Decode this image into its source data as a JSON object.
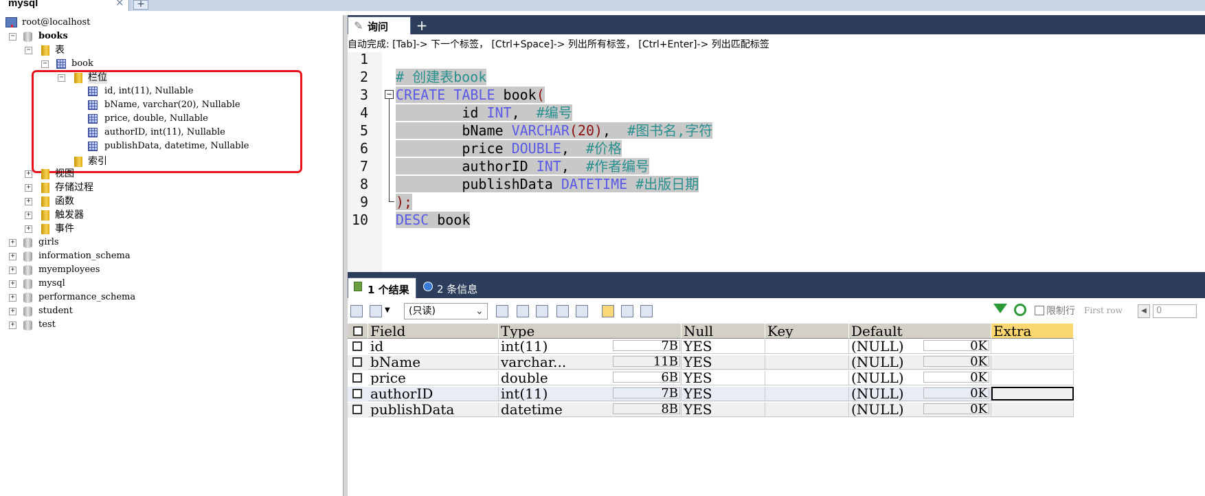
{
  "window": {
    "connection_tab": "mysql",
    "close_symbol": "✕",
    "add_symbol": "+"
  },
  "tree": {
    "root": "root@localhost",
    "db_books": "books",
    "tables_folder": "表",
    "table_book": "book",
    "columns_folder": "栏位",
    "columns": [
      "id, int(11), Nullable",
      "bName, varchar(20), Nullable",
      "price, double, Nullable",
      "authorID, int(11), Nullable",
      "publishData, datetime, Nullable"
    ],
    "index_folder": "索引",
    "folders": [
      "视图",
      "存储过程",
      "函数",
      "触发器",
      "事件"
    ],
    "databases": [
      "girls",
      "information_schema",
      "myemployees",
      "mysql",
      "performance_schema",
      "student",
      "test"
    ]
  },
  "editor": {
    "tab_label": "询问",
    "add_symbol": "+",
    "autocomplete_hint": "自动完成: [Tab]-> 下一个标签， [Ctrl+Space]-> 列出所有标签， [Ctrl+Enter]-> 列出匹配标签",
    "line_numbers": [
      "1",
      "2",
      "3",
      "4",
      "5",
      "6",
      "7",
      "8",
      "9",
      "10"
    ],
    "lines": {
      "l2": "# 创建表book",
      "l3_kw": "CREATE TABLE",
      "l3_rest": " book",
      "l3_paren": "(",
      "l4_name": "        id ",
      "l4_type": "INT",
      "l4_sep": ",  ",
      "l4_cm": "#编号",
      "l5_name": "        bName ",
      "l5_type": "VARCHAR",
      "l5_args": "(20)",
      "l5_sep": ",  ",
      "l5_cm": "#图书名,字符",
      "l6_name": "        price ",
      "l6_type": "DOUBLE",
      "l6_sep": ",  ",
      "l6_cm": "#价格",
      "l7_name": "        authorID ",
      "l7_type": "INT",
      "l7_sep": ",  ",
      "l7_cm": "#作者编号",
      "l8_name": "        publishData ",
      "l8_type": "DATETIME",
      "l8_sep": " ",
      "l8_cm": "#出版日期",
      "l9": ");",
      "l10_kw": "DESC",
      "l10_rest": " book"
    }
  },
  "results": {
    "tab_result": "1 个结果",
    "tab_info": "2 条信息",
    "mode_select": "(只读)",
    "limit_label": "限制行",
    "first_row_label": "First row",
    "first_row_value": "0",
    "columns": [
      "Field",
      "Type",
      "Null",
      "Key",
      "Default",
      "Extra"
    ],
    "rows": [
      {
        "field": "id",
        "type": "int(11)",
        "type_size": "7B",
        "null": "YES",
        "key": "",
        "default": "(NULL)",
        "default_size": "0K",
        "extra": ""
      },
      {
        "field": "bName",
        "type": "varchar...",
        "type_size": "11B",
        "null": "YES",
        "key": "",
        "default": "(NULL)",
        "default_size": "0K",
        "extra": ""
      },
      {
        "field": "price",
        "type": "double",
        "type_size": "6B",
        "null": "YES",
        "key": "",
        "default": "(NULL)",
        "default_size": "0K",
        "extra": ""
      },
      {
        "field": "authorID",
        "type": "int(11)",
        "type_size": "7B",
        "null": "YES",
        "key": "",
        "default": "(NULL)",
        "default_size": "0K",
        "extra": ""
      },
      {
        "field": "publishData",
        "type": "datetime",
        "type_size": "8B",
        "null": "YES",
        "key": "",
        "default": "(NULL)",
        "default_size": "0K",
        "extra": ""
      }
    ]
  }
}
